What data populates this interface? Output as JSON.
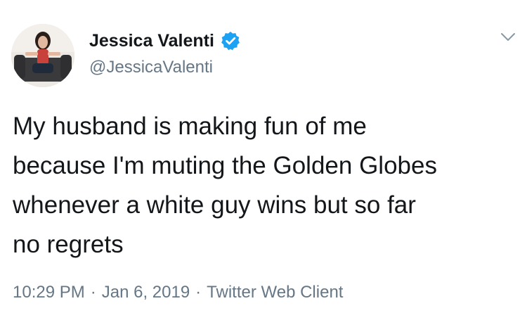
{
  "tweet": {
    "author": {
      "display_name": "Jessica Valenti",
      "handle": "@JessicaValenti",
      "verified": true
    },
    "text_lines": [
      "My husband is making fun of me",
      "because I'm muting the Golden Globes",
      "whenever a white guy wins but so far",
      "no regrets"
    ],
    "time": "10:29 PM",
    "date": "Jan 6, 2019",
    "separator": "·",
    "source": "Twitter Web Client"
  },
  "icons": {
    "verified": "verified-badge-icon",
    "more": "chevron-down-icon"
  },
  "colors": {
    "text": "#14171a",
    "secondary": "#657786",
    "verified": "#1da1f2"
  }
}
